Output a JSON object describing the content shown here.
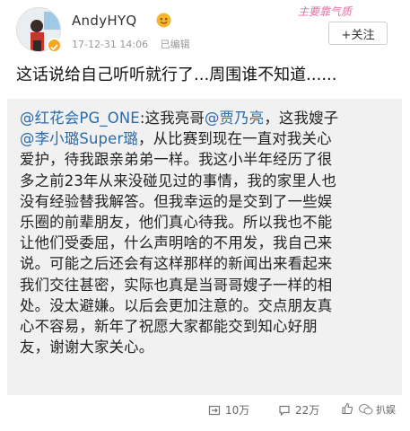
{
  "header": {
    "username": "AndyHYQ",
    "timestamp": "17-12-31 14:06",
    "edited_label": "已编辑",
    "follow_label": "+关注",
    "watermark_tag": "主要靠气质"
  },
  "post": {
    "caption": "这话说给自己听听就行了...周围谁不知道......"
  },
  "quoted": {
    "lines": [
      {
        "segments": [
          {
            "t": "@红花会PG_ONE",
            "m": true
          },
          {
            "t": ":这我亮哥",
            "m": false
          },
          {
            "t": "@贾乃亮",
            "m": true
          },
          {
            "t": "，这我嫂子",
            "m": false
          }
        ]
      },
      {
        "segments": [
          {
            "t": "@李小璐Super璐",
            "m": true
          },
          {
            "t": "，从比赛到现在一直对我关心",
            "m": false
          }
        ]
      },
      {
        "segments": [
          {
            "t": "爱护，待我跟亲弟弟一样。我这小半年经历了很",
            "m": false
          }
        ]
      },
      {
        "segments": [
          {
            "t": "多之前23年从来没碰见过的事情，我的家里人也",
            "m": false
          }
        ]
      },
      {
        "segments": [
          {
            "t": "没有经验替我解答。但我幸运的是交到了一些娱",
            "m": false
          }
        ]
      },
      {
        "segments": [
          {
            "t": "乐圈的前辈朋友，他们真心待我。所以我也不能",
            "m": false
          }
        ]
      },
      {
        "segments": [
          {
            "t": "让他们受委屈，什么声明啥的不用发，我自己来",
            "m": false
          }
        ]
      },
      {
        "segments": [
          {
            "t": "说。可能之后还会有这样那样的新闻出来看起来",
            "m": false
          }
        ]
      },
      {
        "segments": [
          {
            "t": "我们交往甚密，实际也真是当哥哥嫂子一样的相",
            "m": false
          }
        ]
      },
      {
        "segments": [
          {
            "t": "处。没太避嫌。以后会更加注意的。交点朋友真",
            "m": false
          }
        ]
      },
      {
        "segments": [
          {
            "t": "心不容易，新年了祝愿大家都能交到知心好朋",
            "m": false
          }
        ]
      },
      {
        "segments": [
          {
            "t": "友，谢谢大家关心。",
            "m": false
          }
        ]
      }
    ]
  },
  "actions": {
    "repost_count": "10万",
    "comment_count": "22万",
    "like_count": "",
    "watermark_text": "扒娱"
  },
  "colors": {
    "mention": "#2b6aa8",
    "quote_bg": "#f1f1f1",
    "meta_gray": "#9a9a9a"
  }
}
